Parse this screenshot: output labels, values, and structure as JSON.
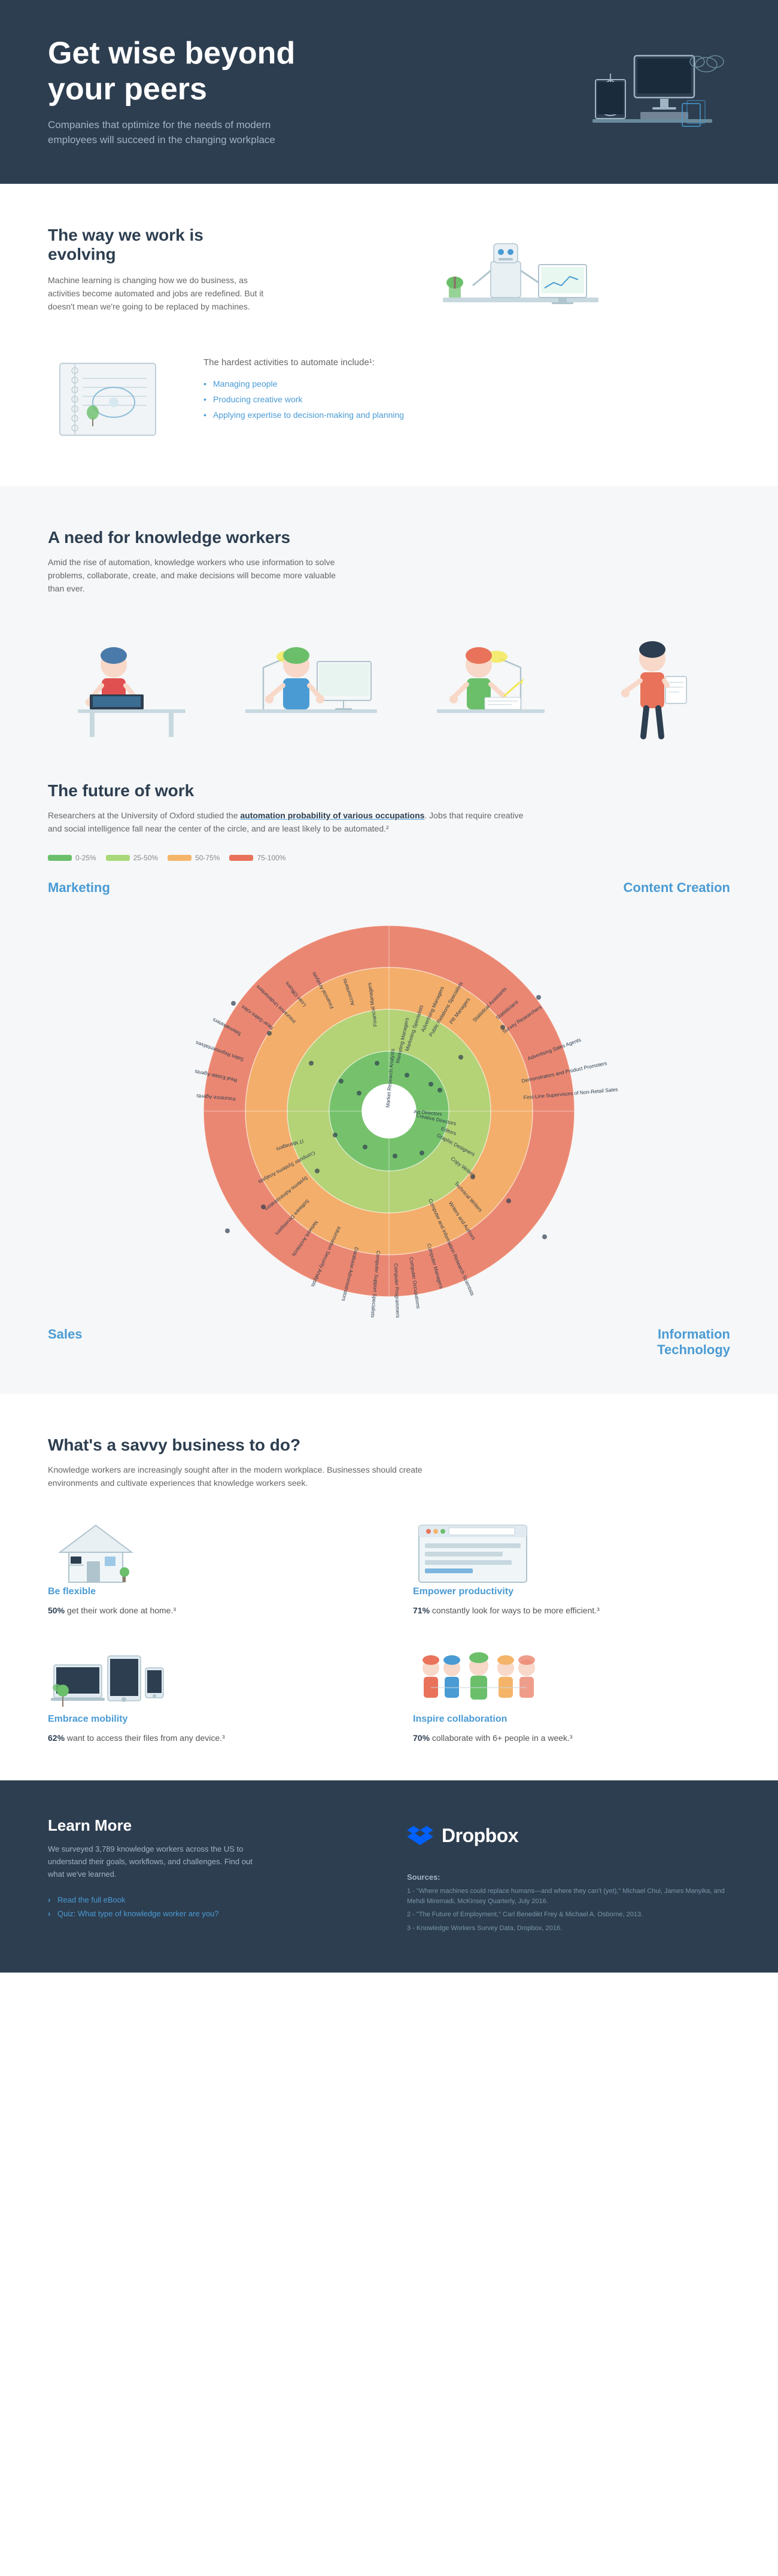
{
  "hero": {
    "title": "Get wise beyond your peers",
    "subtitle": "Companies that optimize for the needs of modern employees will succeed in the changing workplace"
  },
  "evolving": {
    "section_title": "The way we work is evolving",
    "body": "Machine learning is changing how we do business, as activities become automated and jobs are redefined. But it doesn't mean we're going to be replaced by machines.",
    "hardest_title": "The hardest activities to automate include¹:",
    "hardest_items": [
      "Managing people",
      "Producing creative work",
      "Applying expertise to decision-making and planning"
    ]
  },
  "knowledge": {
    "section_title": "A need for knowledge workers",
    "body": "Amid the rise of automation, knowledge workers who use information to solve problems, collaborate, create, and make decisions will become more valuable than ever."
  },
  "future": {
    "section_title": "The future of work",
    "body_prefix": "Researchers at the University of Oxford studied the ",
    "body_link": "automation probability of various occupations",
    "body_suffix": ". Jobs that require creative and social intelligence fall near the center of the circle, and are least likely to be automated.²",
    "legend": [
      {
        "label": "0-25%",
        "class": "legend-0"
      },
      {
        "label": "25-50%",
        "class": "legend-25"
      },
      {
        "label": "50-75%",
        "class": "legend-50"
      },
      {
        "label": "75-100%",
        "class": "legend-75"
      }
    ],
    "quadrant_labels": {
      "top_left": "Marketing",
      "top_right": "Content Creation",
      "bottom_left": "Sales",
      "bottom_right": "Information\nTechnology"
    },
    "chart": {
      "rings": [
        {
          "color": "#e8735a",
          "r": 310,
          "opacity": 1
        },
        {
          "color": "#f4b56a",
          "r": 240,
          "opacity": 1
        },
        {
          "color": "#a8d878",
          "r": 170,
          "opacity": 1
        },
        {
          "color": "#6bbf6b",
          "r": 100,
          "opacity": 1
        },
        {
          "color": "#fff",
          "r": 45,
          "opacity": 1
        }
      ],
      "jobs_marketing": [
        "Market Research Analysts",
        "Marketing Managers",
        "Marketing Specialists",
        "Advertising Managers",
        "Public Relations Specialists",
        "Public Relations Managers",
        "Statistical Assistants",
        "Statisticians",
        "Survey Researchers",
        "Advertising Sales Agents",
        "Demonstrators and Product Promoters",
        "First-Line Supervisors of Non-Retail Sales Workers"
      ],
      "jobs_content": [
        "Art Directors",
        "Creative Directors",
        "Editors",
        "Graphic Designers",
        "Copy Writers",
        "Technical Writers",
        "Writers and Authors",
        "Computer and Information Research Scientists",
        "Computer Managers",
        "Computer Occupations",
        "Computer Programmers",
        "Computer Support Specialists"
      ],
      "jobs_sales": [
        "Insurance Agents",
        "Real Estate Agents",
        "Sales Representatives",
        "Telemarketers"
      ],
      "jobs_it": [
        "Computer Systems Analysts",
        "Database Administrators",
        "Information Security Analysts",
        "Network Architects",
        "Software Developers"
      ]
    }
  },
  "savvy": {
    "section_title": "What's a savvy business to do?",
    "body": "Knowledge workers are increasingly sought after in the modern workplace. Businesses should create environments and cultivate experiences that knowledge workers seek.",
    "items": [
      {
        "title": "Be flexible",
        "stat": "50%",
        "desc_prefix": "",
        "desc": "get their work done at home.³",
        "icon": "home"
      },
      {
        "title": "Empower productivity",
        "stat": "71%",
        "desc": "constantly look for ways to be more efficient.³",
        "icon": "productivity"
      },
      {
        "title": "Embrace mobility",
        "stat": "62%",
        "desc": "want to access their files from any device.³",
        "icon": "mobile"
      },
      {
        "title": "Inspire collaboration",
        "stat": "70%",
        "desc": "collaborate with 6+ people in a week.³",
        "icon": "collaboration"
      }
    ]
  },
  "footer": {
    "learn_title": "Learn More",
    "learn_body": "We surveyed 3,789 knowledge workers across the US to understand their goals, workflows, and challenges. Find out what we've learned.",
    "links": [
      "Read the full eBook",
      "Quiz: What type of knowledge worker are you?"
    ],
    "brand": "Dropbox",
    "sources_title": "Sources:",
    "sources": [
      "1 - \"Where machines could replace humans—and where they can't (yet),\" Michael Chui, James Manyika, and Mehdi Miremadi, McKinsey Quarterly, July 2016.",
      "2 - \"The Future of Employment,\" Carl Benedikt Frey & Michael A. Osborne, 2013.",
      "3 - Knowledge Workers Survey Data, Dropbox, 2016."
    ]
  }
}
